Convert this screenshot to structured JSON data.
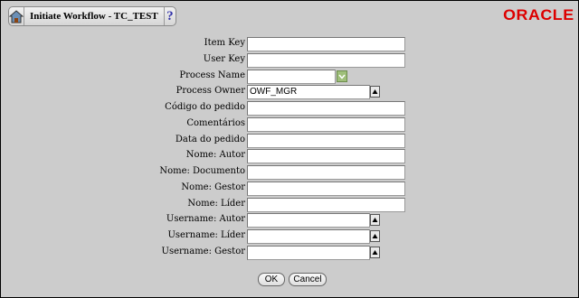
{
  "header": {
    "title": "Initiate Workflow - TC_TEST",
    "help_icon_text": "?",
    "logo_text": "ORACLE",
    "logo_color": "#dd0000"
  },
  "form": {
    "fields": [
      {
        "label": "Item Key",
        "value": "",
        "kind": "text"
      },
      {
        "label": "User Key",
        "value": "",
        "kind": "text"
      },
      {
        "label": "Process Name",
        "value": "",
        "kind": "select"
      },
      {
        "label": "Process Owner",
        "value": "OWF_MGR",
        "kind": "lov"
      },
      {
        "label": "Código do pedido",
        "value": "",
        "kind": "text"
      },
      {
        "label": "Comentários",
        "value": "",
        "kind": "text"
      },
      {
        "label": "Data do pedido",
        "value": "",
        "kind": "text"
      },
      {
        "label": "Nome: Autor",
        "value": "",
        "kind": "text"
      },
      {
        "label": "Nome: Documento",
        "value": "",
        "kind": "text"
      },
      {
        "label": "Nome: Gestor",
        "value": "",
        "kind": "text"
      },
      {
        "label": "Nome: Líder",
        "value": "",
        "kind": "text"
      },
      {
        "label": "Username: Autor",
        "value": "",
        "kind": "lov"
      },
      {
        "label": "Username: Líder",
        "value": "",
        "kind": "lov"
      },
      {
        "label": "Username: Gestor",
        "value": "",
        "kind": "lov"
      }
    ]
  },
  "buttons": {
    "ok_label": "OK",
    "cancel_label": "Cancel"
  }
}
